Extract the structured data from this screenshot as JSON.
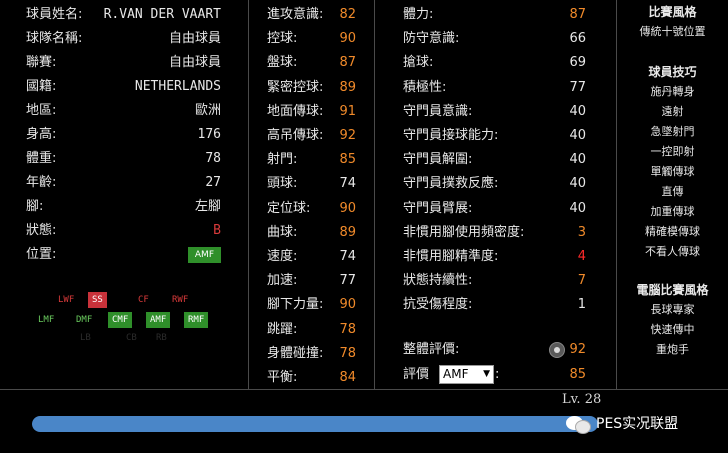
{
  "colors": {
    "orange": "#f08a2a",
    "white": "#e8e8e8",
    "red": "#ff2a2a",
    "green_badge": "#2f8f2a",
    "bar_blue": "#4a86c8"
  },
  "info": {
    "rows": [
      {
        "label": "球員姓名:",
        "value": "R.VAN DER VAART"
      },
      {
        "label": "球隊名稱:",
        "value": "自由球員"
      },
      {
        "label": "聯賽:",
        "value": "自由球員"
      },
      {
        "label": "國籍:",
        "value": "NETHERLANDS"
      },
      {
        "label": "地區:",
        "value": "歐洲"
      },
      {
        "label": "身高:",
        "value": "176"
      },
      {
        "label": "體重:",
        "value": "78"
      },
      {
        "label": "年齡:",
        "value": "27"
      },
      {
        "label": "腳:",
        "value": "左腳"
      },
      {
        "label": "狀態:",
        "value": "B"
      },
      {
        "label": "位置:",
        "value": "AMF"
      }
    ]
  },
  "positions": {
    "row1": [
      "LWF",
      "SS",
      "CF",
      "RWF"
    ],
    "row2": [
      "LMF",
      "DMF",
      "CMF",
      "AMF",
      "RMF"
    ],
    "row3": [
      "LB",
      "CB",
      "RB"
    ]
  },
  "stats_mid": [
    {
      "label": "進攻意識:",
      "value": "82"
    },
    {
      "label": "控球:",
      "value": "90"
    },
    {
      "label": "盤球:",
      "value": "87"
    },
    {
      "label": "緊密控球:",
      "value": "89"
    },
    {
      "label": "地面傳球:",
      "value": "91"
    },
    {
      "label": "高吊傳球:",
      "value": "92"
    },
    {
      "label": "射門:",
      "value": "85"
    },
    {
      "label": "頭球:",
      "value": "74"
    },
    {
      "label": "定位球:",
      "value": "90"
    },
    {
      "label": "曲球:",
      "value": "89"
    },
    {
      "label": "速度:",
      "value": "74"
    },
    {
      "label": "加速:",
      "value": "77"
    },
    {
      "label": "腳下力量:",
      "value": "90"
    },
    {
      "label": "跳躍:",
      "value": "78"
    },
    {
      "label": "身體碰撞:",
      "value": "78"
    },
    {
      "label": "平衡:",
      "value": "84"
    }
  ],
  "stats_right": [
    {
      "label": "體力:",
      "value": "87"
    },
    {
      "label": "防守意識:",
      "value": "66"
    },
    {
      "label": "搶球:",
      "value": "69"
    },
    {
      "label": "積極性:",
      "value": "77"
    },
    {
      "label": "守門員意識:",
      "value": "40"
    },
    {
      "label": "守門員接球能力:",
      "value": "40"
    },
    {
      "label": "守門員解圍:",
      "value": "40"
    },
    {
      "label": "守門員撲救反應:",
      "value": "40"
    },
    {
      "label": "守門員臂展:",
      "value": "40"
    },
    {
      "label": "非慣用腳使用頻密度:",
      "value": "3"
    },
    {
      "label": "非慣用腳精準度:",
      "value": "4"
    },
    {
      "label": "狀態持續性:",
      "value": "7"
    },
    {
      "label": "抗受傷程度:",
      "value": "1"
    }
  ],
  "overall": {
    "label": "整體評價:",
    "value": "92"
  },
  "rating": {
    "label": "評價",
    "select_value": "AMF",
    "colon": ":",
    "value": "85"
  },
  "side": {
    "style_title": "比賽風格",
    "style_value": "傳統十號位置",
    "skills_title": "球員技巧",
    "skills": [
      "施丹轉身",
      "遠射",
      "急墜射門",
      "一控即射",
      "單觸傳球",
      "直傳",
      "加重傳球",
      "精確模傳球",
      "不看人傳球"
    ],
    "ai_title": "電腦比賽風格",
    "ai": [
      "長球專家",
      "快速傳中",
      "重炮手"
    ]
  },
  "level": {
    "label": "Lv. 28",
    "progress_pct": 100
  },
  "watermark": "PES实况联盟"
}
